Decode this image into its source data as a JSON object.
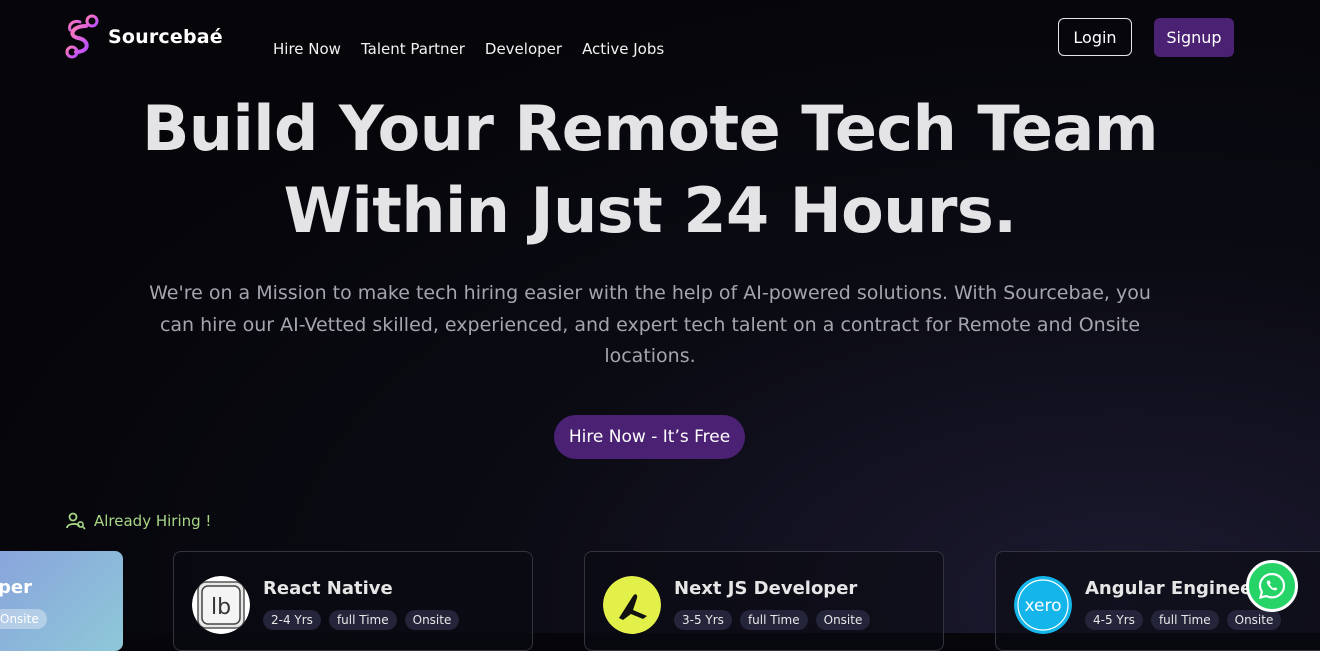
{
  "header": {
    "logo_text": "Sourcebaé",
    "nav": [
      "Hire Now",
      "Talent Partner",
      "Developer",
      "Active Jobs"
    ],
    "login_label": "Login",
    "signup_label": "Signup"
  },
  "hero": {
    "line1": "Build Your Remote Tech Team",
    "line2": "Within Just 24 Hours.",
    "subtitle": "We're on a Mission to make tech hiring easier with the help of AI-powered solutions. With Sourcebae, you can hire our AI-Vetted skilled, experienced, and expert tech talent on a contract for Remote and Onsite locations.",
    "cta_label": "Hire Now - It’s Free"
  },
  "hiring": {
    "label": "Already Hiring !",
    "partial_card": {
      "title_fragment": "per",
      "tag_fragment": "Onsite"
    },
    "cards": [
      {
        "title": "React Native",
        "logo": "lb-logo",
        "tags": [
          "2-4 Yrs",
          "full Time",
          "Onsite"
        ]
      },
      {
        "title": "Next JS Developer",
        "logo": "yellow-brand-logo",
        "tags": [
          "3-5 Yrs",
          "full Time",
          "Onsite"
        ]
      },
      {
        "title": "Angular Engineer",
        "logo": "xero-logo",
        "logo_text": "xero",
        "tags": [
          "4-5 Yrs",
          "full Time",
          "Onsite"
        ]
      }
    ]
  },
  "colors": {
    "accent_purple": "#4b2173",
    "hiring_green": "#a7d686",
    "whatsapp_green": "#25d366"
  }
}
